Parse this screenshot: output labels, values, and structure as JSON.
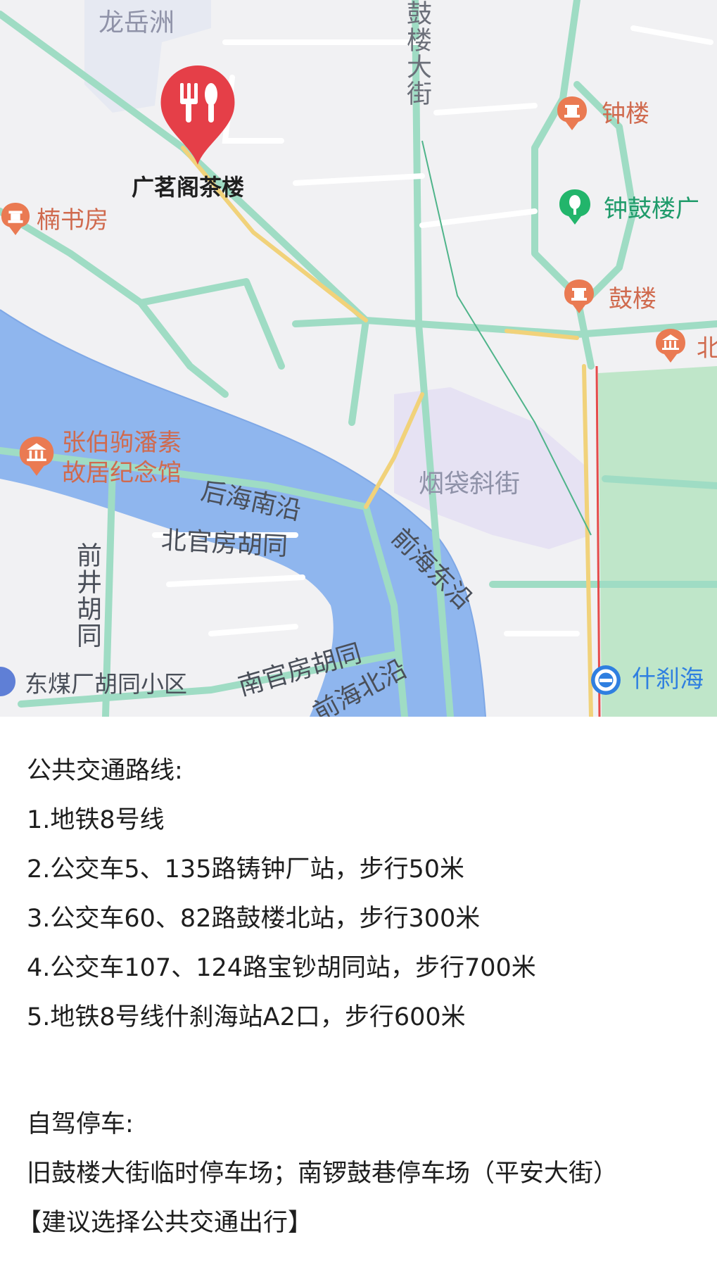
{
  "map": {
    "marker": {
      "name": "广茗阁茶楼",
      "icon": "restaurant-icon",
      "color": "#e53f48"
    },
    "pois": [
      {
        "key": "zhonglou",
        "label": "钟楼",
        "icon": "landmark-icon",
        "type": "orange"
      },
      {
        "key": "zhongguloguang",
        "label": "钟鼓楼广",
        "icon": "park-icon",
        "type": "green"
      },
      {
        "key": "gulou",
        "label": "鼓楼",
        "icon": "landmark-icon",
        "type": "orange"
      },
      {
        "key": "bei",
        "label": "北",
        "icon": "museum-icon",
        "type": "orange"
      },
      {
        "key": "nanshufang",
        "label": "楠书房",
        "icon": "landmark-icon",
        "type": "orange"
      },
      {
        "key": "zhangbaiju_1",
        "label": "张伯驹潘素",
        "icon": "museum-icon",
        "type": "orange"
      },
      {
        "key": "zhangbaiju_2",
        "label": "故居纪念馆",
        "type": "orange"
      },
      {
        "key": "shichahai",
        "label": "什刹海",
        "icon": "subway-icon",
        "type": "blue"
      },
      {
        "key": "dongmeichang",
        "label": "东煤厂胡同小区",
        "icon": "residence-icon",
        "type": "blue"
      }
    ],
    "areas": {
      "longyuezhou": "龙岳洲",
      "yandaixiejie": "烟袋斜街"
    },
    "streets": {
      "gulou_dajie": "鼓楼大街",
      "houhai_nanyan": "后海南沿",
      "beiguanfang": "北官房胡同",
      "qianjing": "前井胡同",
      "nanguanfang": "南官房胡同",
      "qianhai_dongyan": "前海东沿",
      "qianhai_beiyan": "前海北沿"
    },
    "colors": {
      "land": "#f1f1f3",
      "water": "#8fb6ee",
      "park": "#bfe6c9",
      "road_green": "#9fdcc4",
      "road_yellow": "#f1d27a",
      "district": "#e6e2f3",
      "subway_line": "#e54b4b"
    }
  },
  "info": {
    "transit_title": "公共交通路线:",
    "transit_routes": [
      "1.地铁8号线",
      "2.公交车5、135路铸钟厂站，步行50米",
      "3.公交车60、82路鼓楼北站，步行300米",
      "4.公交车107、124路宝钞胡同站，步行700米",
      "5.地铁8号线什刹海站A2口，步行600米"
    ],
    "parking_title": "自驾停车:",
    "parking_text": "旧鼓楼大街临时停车场；南锣鼓巷停车场（平安大街）",
    "suggestion": "【建议选择公共交通出行】"
  }
}
